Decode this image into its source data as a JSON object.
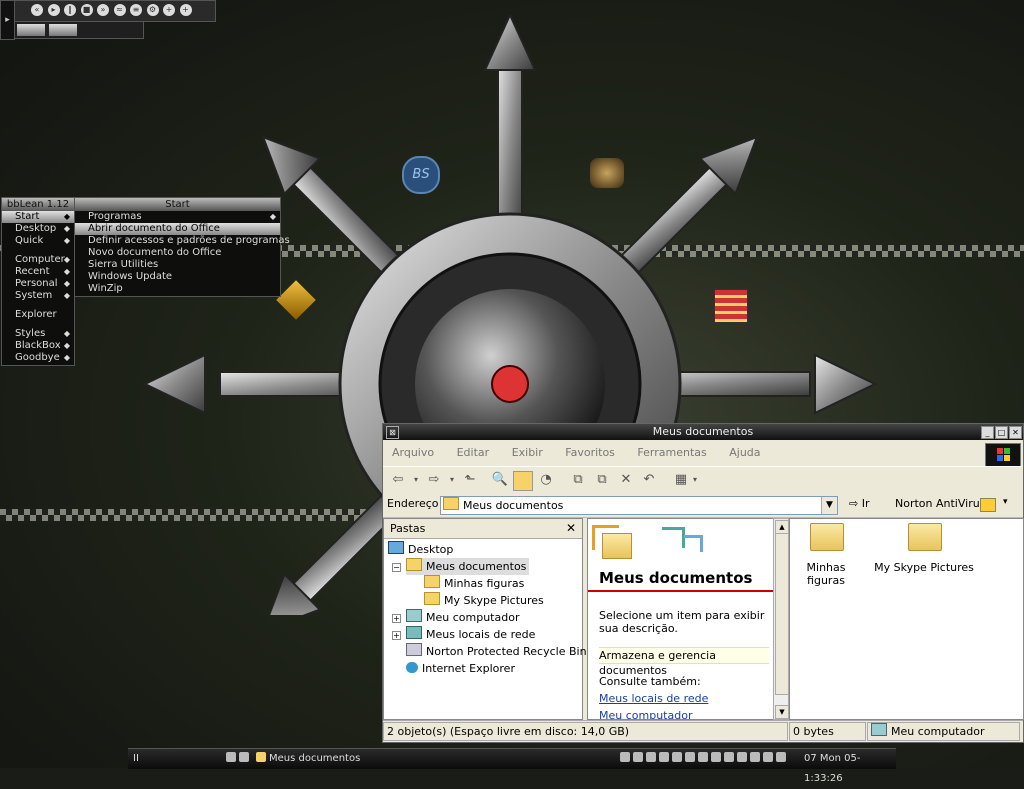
{
  "bbmenu": {
    "title": "bbLean 1.12",
    "items": [
      "Start",
      "Desktop",
      "Quick",
      "Computer",
      "Recent",
      "Personal",
      "System",
      "Explorer",
      "Styles",
      "BlackBox",
      "Goodbye"
    ]
  },
  "startmenu": {
    "title": "Start",
    "items": [
      "Programas",
      "Abrir documento do Office",
      "Definir acessos e padrões de programas",
      "Novo documento do Office",
      "Sierra Utilities",
      "Windows Update",
      "WinZip"
    ]
  },
  "desktop_icons": {
    "bs_label": "BS"
  },
  "window": {
    "title": "Meus documentos",
    "menu": [
      "Arquivo",
      "Editar",
      "Exibir",
      "Favoritos",
      "Ferramentas",
      "Ajuda"
    ],
    "address_label": "Endereço",
    "address_value": "Meus documentos",
    "go_label": "Ir",
    "norton_label": "Norton AntiVirus",
    "folders_header": "Pastas",
    "tree": [
      "Desktop",
      "Meus documentos",
      "Minhas figuras",
      "My Skype Pictures",
      "Meu computador",
      "Meus locais de rede",
      "Norton Protected Recycle Bin",
      "Internet Explorer"
    ],
    "task": {
      "heading": "Meus documentos",
      "prompt": "Selecione um item para exibir sua descrição.",
      "info": "Armazena e gerencia documentos",
      "see_also": "Consulte também:",
      "links": [
        "Meus locais de rede",
        "Meu computador"
      ]
    },
    "files": [
      "Minhas figuras",
      "My Skype Pictures"
    ],
    "status": {
      "objects": "2 objeto(s) (Espaço livre em disco: 14,0 GB)",
      "size": "0 bytes",
      "location": "Meu computador"
    }
  },
  "taskbar": {
    "workspace": "II",
    "task": "Meus documentos",
    "clock": "07 Mon 05-1:33:26"
  }
}
